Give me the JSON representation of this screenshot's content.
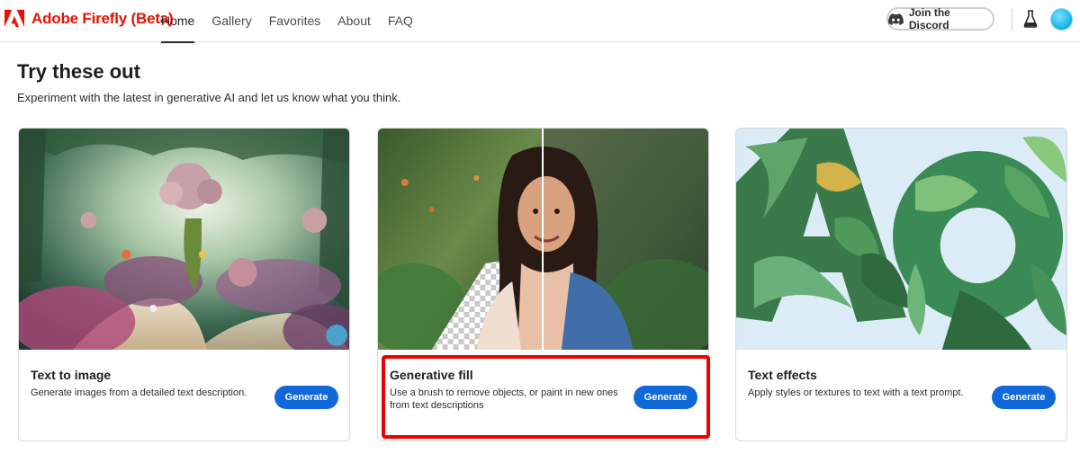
{
  "brand": {
    "name": "Adobe Firefly (Beta)"
  },
  "nav": {
    "items": [
      {
        "label": "Home",
        "active": true
      },
      {
        "label": "Gallery",
        "active": false
      },
      {
        "label": "Favorites",
        "active": false
      },
      {
        "label": "About",
        "active": false
      },
      {
        "label": "FAQ",
        "active": false
      }
    ]
  },
  "header": {
    "discord_label": "Join the Discord"
  },
  "intro": {
    "title": "Try these out",
    "subtitle": "Experiment with the latest in generative AI and let us know what you think."
  },
  "cards": [
    {
      "title": "Text to image",
      "description": "Generate images from a detailed text description.",
      "button": "Generate",
      "icon": "fantasy-garden-image"
    },
    {
      "title": "Generative fill",
      "description": "Use a brush to remove objects, or paint in new ones from text descriptions",
      "button": "Generate",
      "icon": "woman-portrait-image",
      "highlighted": true
    },
    {
      "title": "Text effects",
      "description": "Apply styles or textures to text with a text prompt.",
      "button": "Generate",
      "icon": "leafy-letters-image"
    }
  ],
  "colors": {
    "brand_red": "#eb1000",
    "button_blue": "#1168d8",
    "highlight_red": "#ef0000"
  }
}
